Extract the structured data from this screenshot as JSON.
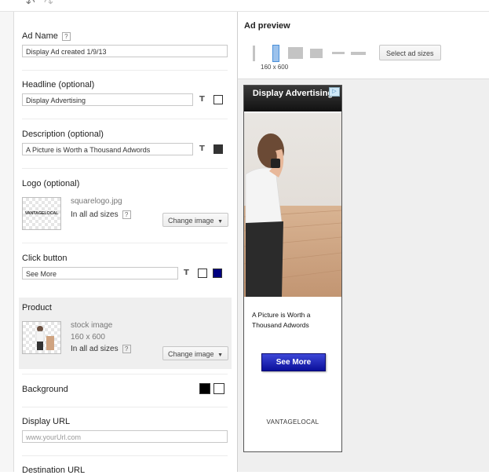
{
  "toolbar": {
    "undo_icon": "undo-icon",
    "redo_icon": "redo-icon"
  },
  "form": {
    "ad_name": {
      "label": "Ad Name",
      "help": "?",
      "value": "Display Ad created 1/9/13"
    },
    "headline": {
      "label": "Headline (optional)",
      "value": "Display Advertising",
      "tool": "T",
      "swatch_color": "#ffffff"
    },
    "description": {
      "label": "Description (optional)",
      "value": "A Picture is Worth a Thousand Adwords",
      "tool": "T",
      "swatch_color": "#333333"
    },
    "logo": {
      "label": "Logo (optional)",
      "thumb_text": "VANTAGELOCAL",
      "filename": "squarelogo.jpg",
      "sizes": "In all ad sizes",
      "help": "?",
      "change_button": "Change image"
    },
    "click_button": {
      "label": "Click button",
      "value": "See More",
      "tool": "T",
      "swatch_text": "#ffffff",
      "swatch_bg": "#000080"
    },
    "product": {
      "label": "Product",
      "source": "stock image",
      "dimensions": "160 x 600",
      "sizes": "In all ad sizes",
      "help": "?",
      "change_button": "Change image"
    },
    "background": {
      "label": "Background",
      "swatch_dark": "#000000",
      "swatch_light": "#ffffff"
    },
    "display_url": {
      "label": "Display URL",
      "placeholder": "www.yourUrl.com"
    },
    "destination_url": {
      "label": "Destination URL"
    }
  },
  "preview": {
    "title": "Ad preview",
    "selected_size": "160 x 600",
    "select_sizes_button": "Select ad sizes",
    "accent_color": "#4a90d9"
  },
  "ad": {
    "headline": "Display Advertising",
    "ad_choices_icon": "adchoices-icon",
    "description": "A Picture is Worth a Thousand Adwords",
    "cta": "See More",
    "brand": "VANTAGELOCAL"
  }
}
